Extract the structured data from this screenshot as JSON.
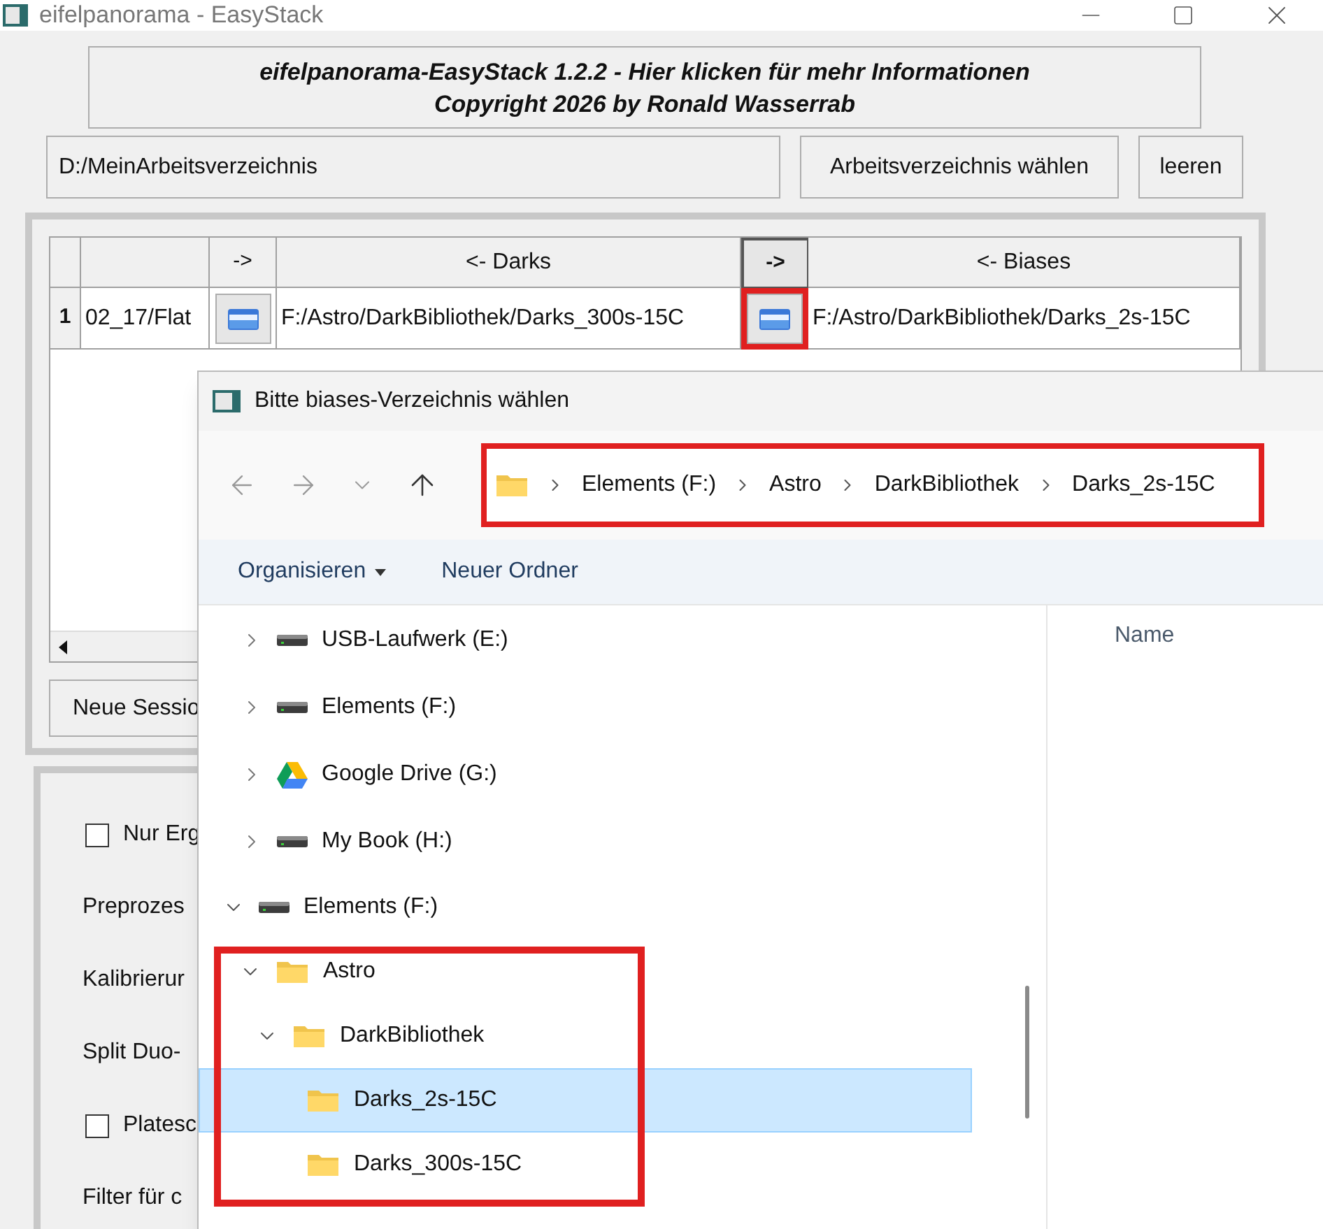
{
  "window": {
    "title": "eifelpanorama - EasyStack"
  },
  "info_button": {
    "line1": "eifelpanorama-EasyStack 1.2.2 - Hier klicken für mehr Informationen",
    "line2": "Copyright 2026 by Ronald Wasserrab"
  },
  "work_dir": {
    "value": "D:/MeinArbeitsverzeichnis",
    "choose_button": "Arbeitsverzeichnis wählen",
    "clear_button": "leeren"
  },
  "table": {
    "columns": [
      {
        "kind": "text"
      },
      {
        "label": "->",
        "kind": "button",
        "pressed": false
      },
      {
        "label": "<- Darks",
        "kind": "text"
      },
      {
        "label": "->",
        "kind": "button",
        "pressed": true
      },
      {
        "label": "<- Biases",
        "kind": "text"
      }
    ],
    "rows": [
      {
        "number": "1",
        "cells": [
          "02_17/Flat",
          "",
          "F:/Astro/DarkBibliothek/Darks_300s-15C",
          "",
          "F:/Astro/DarkBibliothek/Darks_2s-15C"
        ]
      }
    ]
  },
  "session_button": "Neue Sessio",
  "options": [
    {
      "kind": "checkbox",
      "label": "Nur Erg",
      "checked": false
    },
    {
      "kind": "label",
      "label": "Preprozes"
    },
    {
      "kind": "label",
      "label": "Kalibrierur"
    },
    {
      "kind": "label",
      "label": "Split Duo-"
    },
    {
      "kind": "checkbox",
      "label": "Platesc",
      "checked": false
    },
    {
      "kind": "label",
      "label": "Filter für c"
    }
  ],
  "dialog": {
    "title": "Bitte biases-Verzeichnis wählen",
    "breadcrumb": [
      "Elements (F:)",
      "Astro",
      "DarkBibliothek",
      "Darks_2s-15C"
    ],
    "toolbar": {
      "organize": "Organisieren",
      "new_folder": "Neuer Ordner"
    },
    "drives": [
      {
        "label": "USB-Laufwerk (E:)",
        "kind": "drive",
        "expanded": false
      },
      {
        "label": "Elements (F:)",
        "kind": "drive",
        "expanded": false
      },
      {
        "label": "Google Drive (G:)",
        "kind": "cloud",
        "expanded": false
      },
      {
        "label": "My Book (H:)",
        "kind": "drive",
        "expanded": false
      }
    ],
    "tree": [
      {
        "label": "Elements (F:)",
        "kind": "drive",
        "expanded": true,
        "selected": false,
        "children": [
          {
            "label": "Astro",
            "kind": "folder",
            "expanded": true,
            "selected": false,
            "children": [
              {
                "label": "DarkBibliothek",
                "kind": "folder",
                "expanded": true,
                "selected": false,
                "children": [
                  {
                    "label": "Darks_2s-15C",
                    "kind": "folder",
                    "selected": true
                  },
                  {
                    "label": "Darks_300s-15C",
                    "kind": "folder",
                    "selected": false
                  }
                ]
              }
            ]
          }
        ]
      }
    ],
    "column_header": "Name"
  }
}
